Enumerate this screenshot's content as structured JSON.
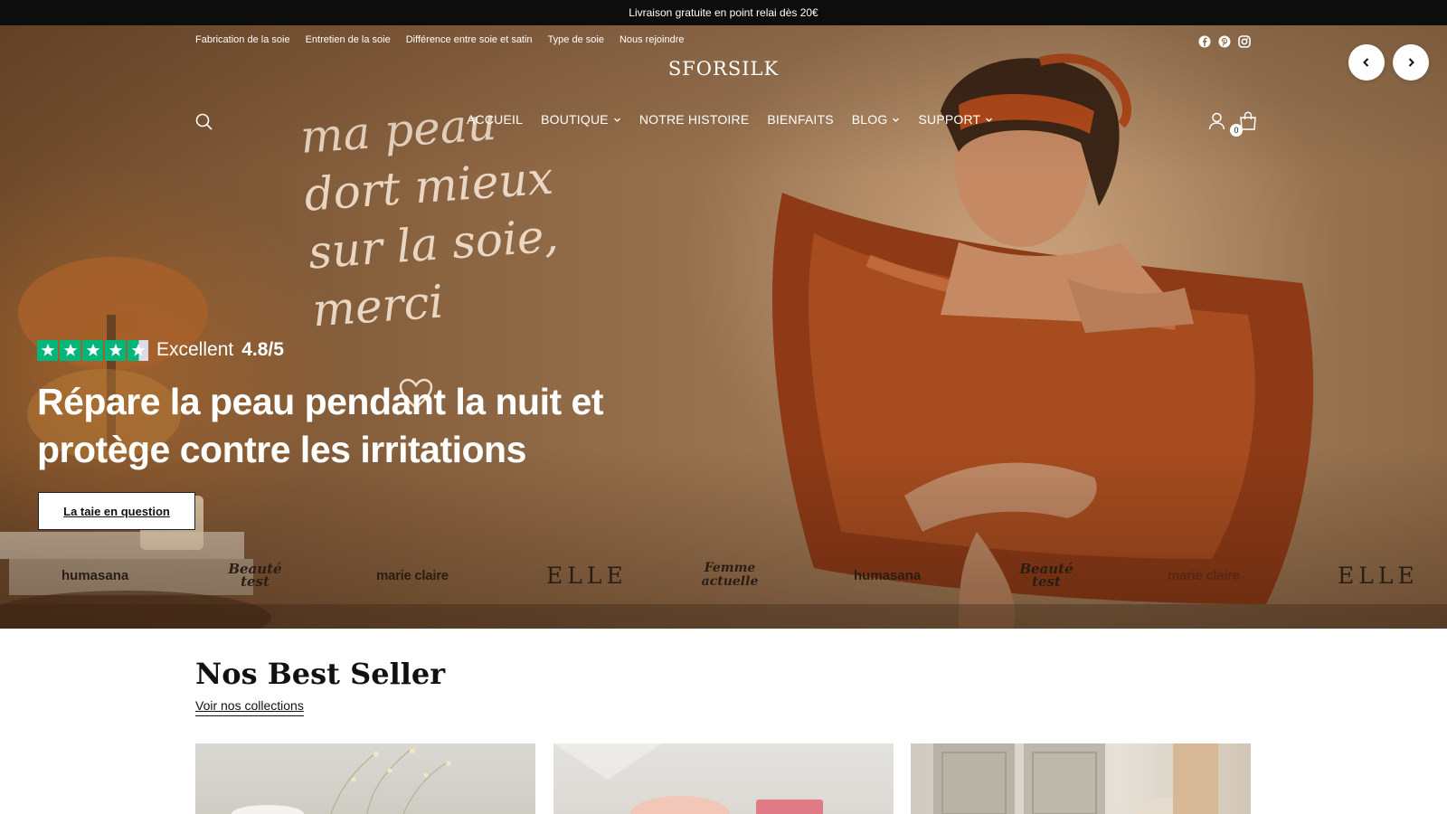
{
  "announcement": {
    "text": "Livraison gratuite en point relai dès 20€"
  },
  "utility_nav": {
    "links": [
      "Fabrication de la soie",
      "Entretien de la soie",
      "Différence entre soie et satin",
      "Type de soie",
      "Nous rejoindre"
    ]
  },
  "social": {
    "icons": [
      "facebook-icon",
      "pinterest-icon",
      "instagram-icon"
    ]
  },
  "brand": {
    "logo": "SFORSILK"
  },
  "main_nav": {
    "items": [
      {
        "label": "ACCUEIL",
        "dropdown": false
      },
      {
        "label": "BOUTIQUE",
        "dropdown": true
      },
      {
        "label": "NOTRE HISTOIRE",
        "dropdown": false
      },
      {
        "label": "BIENFAITS",
        "dropdown": false
      },
      {
        "label": "BLOG",
        "dropdown": true
      },
      {
        "label": "SUPPORT",
        "dropdown": true
      }
    ]
  },
  "cart": {
    "count": "0"
  },
  "hero": {
    "handwriting": [
      "ma peau",
      "dort mieux",
      "sur la soie,",
      "merci"
    ],
    "rating_word": "Excellent",
    "rating_value": "4.8/5",
    "rating_stars": 4.5,
    "headline_line1": "Répare la peau pendant la nuit et",
    "headline_line2": "protège contre les irritations",
    "cta_label": "La taie en question"
  },
  "press": [
    "humasana",
    "Beauté test",
    "marie claire",
    "ELLE",
    "Femme actuelle",
    "humasana",
    "Beauté test",
    "marie claire",
    "ELLE"
  ],
  "best_seller": {
    "title": "Nos Best Seller",
    "link": "Voir nos collections"
  },
  "colors": {
    "announcement_bg": "#0d0d0d",
    "trustpilot_green": "#00b67a",
    "hero_tone": "#9b7653"
  }
}
